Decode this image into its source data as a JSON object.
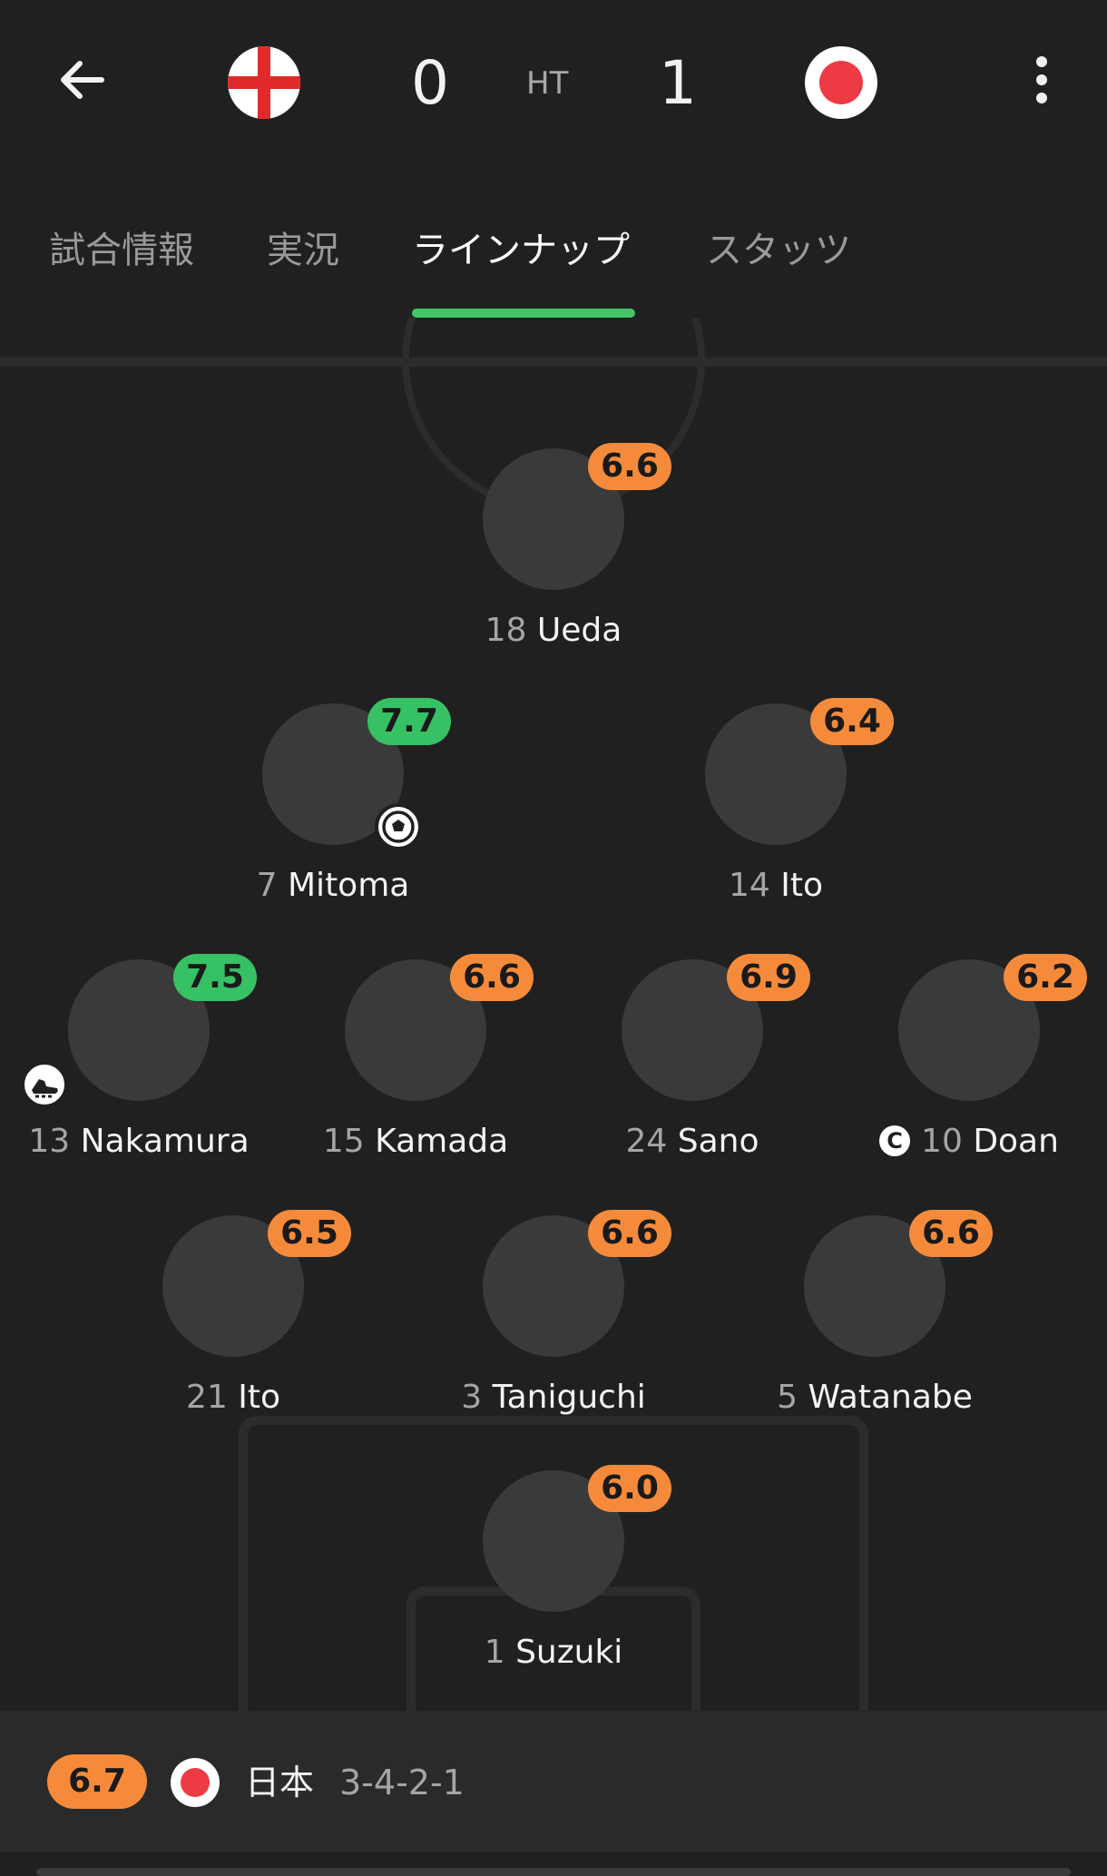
{
  "header": {
    "back_icon": "arrow-left-icon",
    "home_flag": "england-flag",
    "away_flag": "japan-flag",
    "home_score": "0",
    "status": "HT",
    "away_score": "1",
    "more_icon": "more-vertical-icon"
  },
  "tabs": [
    {
      "label": "試合情報",
      "active": false
    },
    {
      "label": "実況",
      "active": false
    },
    {
      "label": "ラインナップ",
      "active": true
    },
    {
      "label": "スタッツ",
      "active": false
    }
  ],
  "colors": {
    "rating_orange": "#f58b3a",
    "rating_green": "#36c164",
    "tab_active_indicator": "#45c46a",
    "background": "#202020"
  },
  "players": [
    {
      "number": "18",
      "name": "Ueda",
      "rating": "6.6",
      "rating_color": "orange"
    },
    {
      "number": "7",
      "name": "Mitoma",
      "rating": "7.7",
      "rating_color": "green",
      "event_icon": "goal-ball-icon"
    },
    {
      "number": "14",
      "name": "Ito",
      "rating": "6.4",
      "rating_color": "orange"
    },
    {
      "number": "13",
      "name": "Nakamura",
      "rating": "7.5",
      "rating_color": "green",
      "event_icon": "assist-boot-icon"
    },
    {
      "number": "15",
      "name": "Kamada",
      "rating": "6.6",
      "rating_color": "orange"
    },
    {
      "number": "24",
      "name": "Sano",
      "rating": "6.9",
      "rating_color": "orange"
    },
    {
      "number": "10",
      "name": "Doan",
      "rating": "6.2",
      "rating_color": "orange",
      "captain": true,
      "captain_label": "C"
    },
    {
      "number": "21",
      "name": "Ito",
      "rating": "6.5",
      "rating_color": "orange"
    },
    {
      "number": "3",
      "name": "Taniguchi",
      "rating": "6.6",
      "rating_color": "orange"
    },
    {
      "number": "5",
      "name": "Watanabe",
      "rating": "6.6",
      "rating_color": "orange"
    },
    {
      "number": "1",
      "name": "Suzuki",
      "rating": "6.0",
      "rating_color": "orange"
    }
  ],
  "team": {
    "rating": "6.7",
    "flag": "japan-flag",
    "name": "日本",
    "formation": "3-4-2-1"
  }
}
